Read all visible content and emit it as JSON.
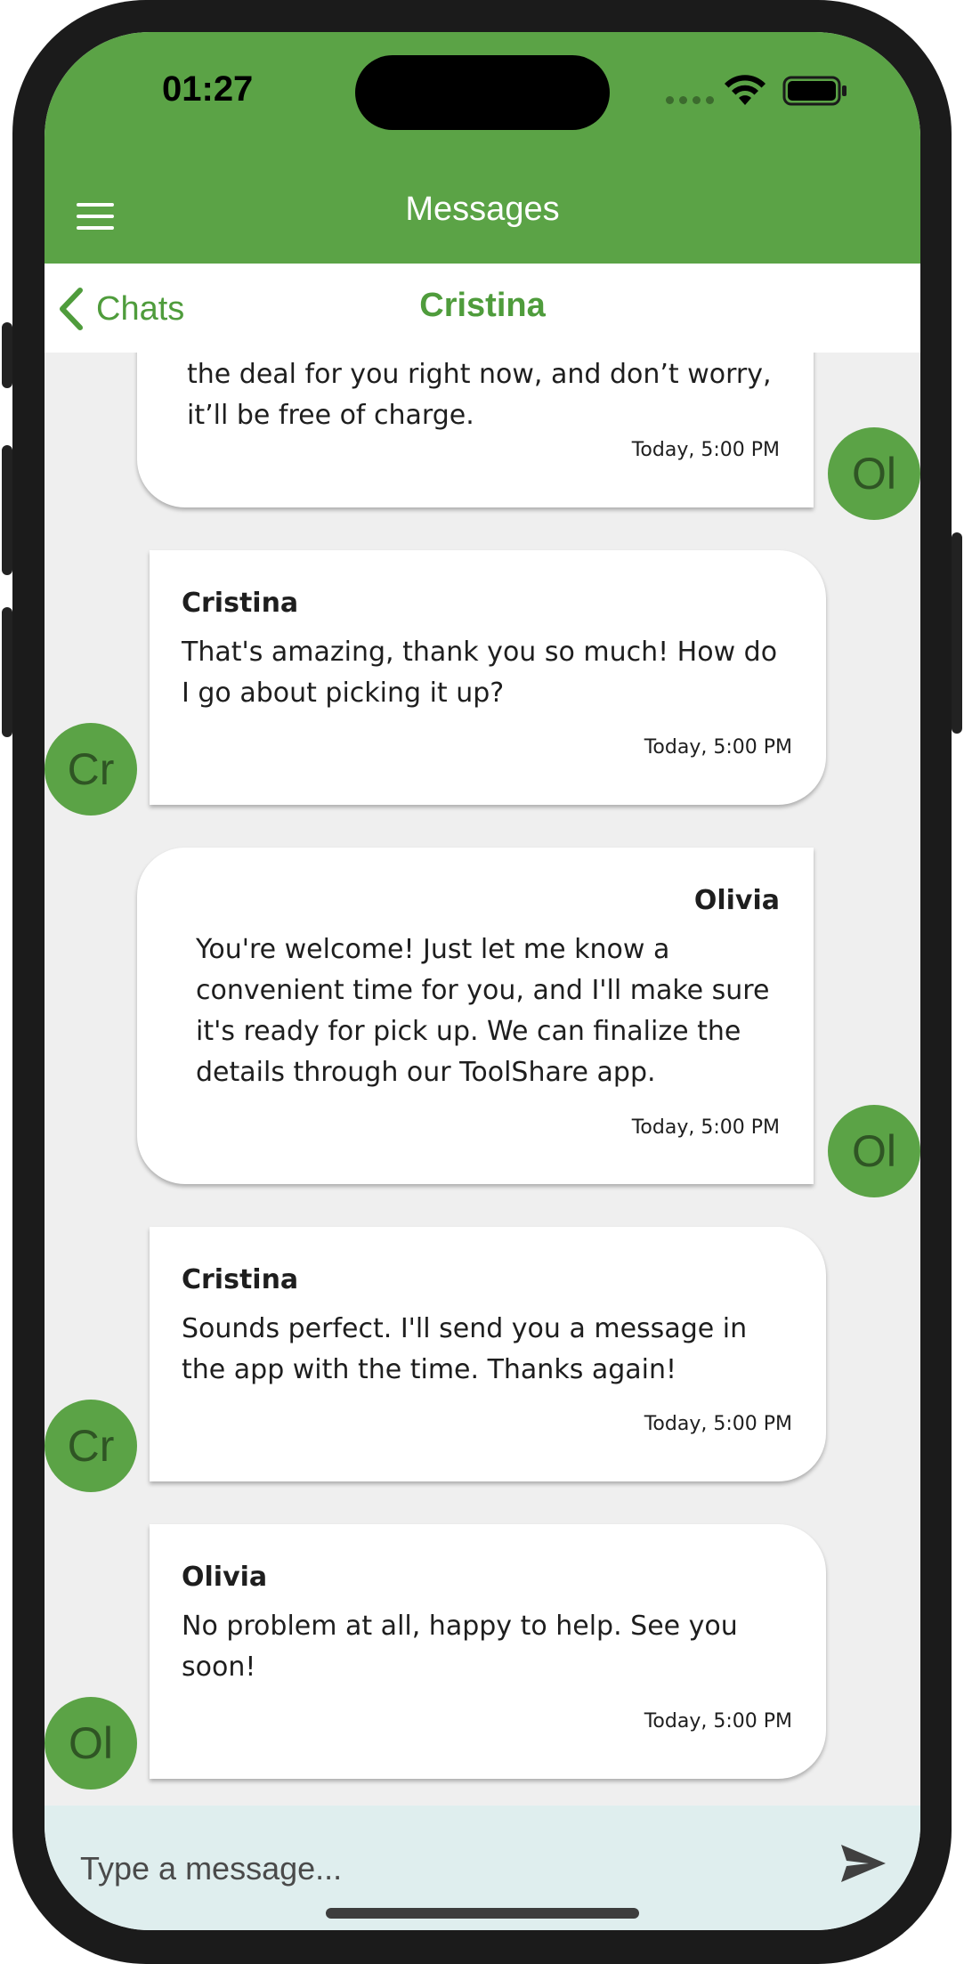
{
  "status_bar": {
    "time": "01:27"
  },
  "app_bar": {
    "title": "Messages",
    "menu_icon": "hamburger-menu-icon"
  },
  "nav_bar": {
    "back_label": "Chats",
    "title": "Cristina",
    "back_icon": "chevron-left-icon"
  },
  "messages": [
    {
      "direction": "outgoing",
      "sender": "",
      "text_lines": [
        "the deal for you right now, and don’t worry,",
        "it’ll be free of charge."
      ],
      "time": "Today, 5:00 PM",
      "avatar": "Ol"
    },
    {
      "direction": "incoming",
      "sender": "Cristina",
      "text_lines": [
        "That's amazing, thank you so much! How do",
        "I go about picking it up?"
      ],
      "time": "Today, 5:00 PM",
      "avatar": "Cr"
    },
    {
      "direction": "outgoing",
      "sender": "Olivia",
      "text_lines": [
        "You're welcome! Just let me know a",
        "convenient time for you, and I'll make sure",
        "it's ready for pick up. We can finalize the",
        "details through our ToolShare app."
      ],
      "time": "Today, 5:00 PM",
      "avatar": "Ol"
    },
    {
      "direction": "incoming",
      "sender": "Cristina",
      "text_lines": [
        "Sounds perfect. I'll send you a message in",
        "the app with the time. Thanks again!"
      ],
      "time": "Today, 5:00 PM",
      "avatar": "Cr"
    },
    {
      "direction": "incoming",
      "sender": "Olivia",
      "text_lines": [
        "No problem at all, happy to help. See you",
        "soon!"
      ],
      "time": "Today, 5:00 PM",
      "avatar": "Ol"
    }
  ],
  "composer": {
    "placeholder": "Type a message...",
    "send_icon": "send-icon"
  },
  "colors": {
    "brand_green": "#5ba346",
    "accent_green": "#4f9c3c",
    "composer_bg": "#dfeeee",
    "chat_bg": "#efefef"
  }
}
